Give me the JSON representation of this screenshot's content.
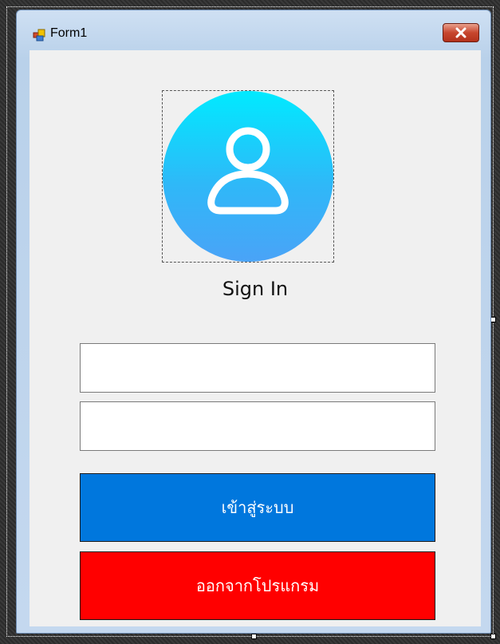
{
  "window": {
    "title": "Form1",
    "icon": "form-icon",
    "close_icon": "close-icon"
  },
  "avatar": {
    "icon": "user-icon"
  },
  "heading": "Sign In",
  "fields": {
    "username": {
      "value": "",
      "placeholder": ""
    },
    "password": {
      "value": "",
      "placeholder": ""
    }
  },
  "buttons": {
    "login_label": "เข้าสู่ระบบ",
    "exit_label": "ออกจากโปรแกรม"
  },
  "colors": {
    "login_button": "#0077dd",
    "exit_button": "#ff0000",
    "avatar_top": "#00eaff",
    "avatar_bottom": "#4aa3f7",
    "form_background": "#f0f0f0"
  }
}
